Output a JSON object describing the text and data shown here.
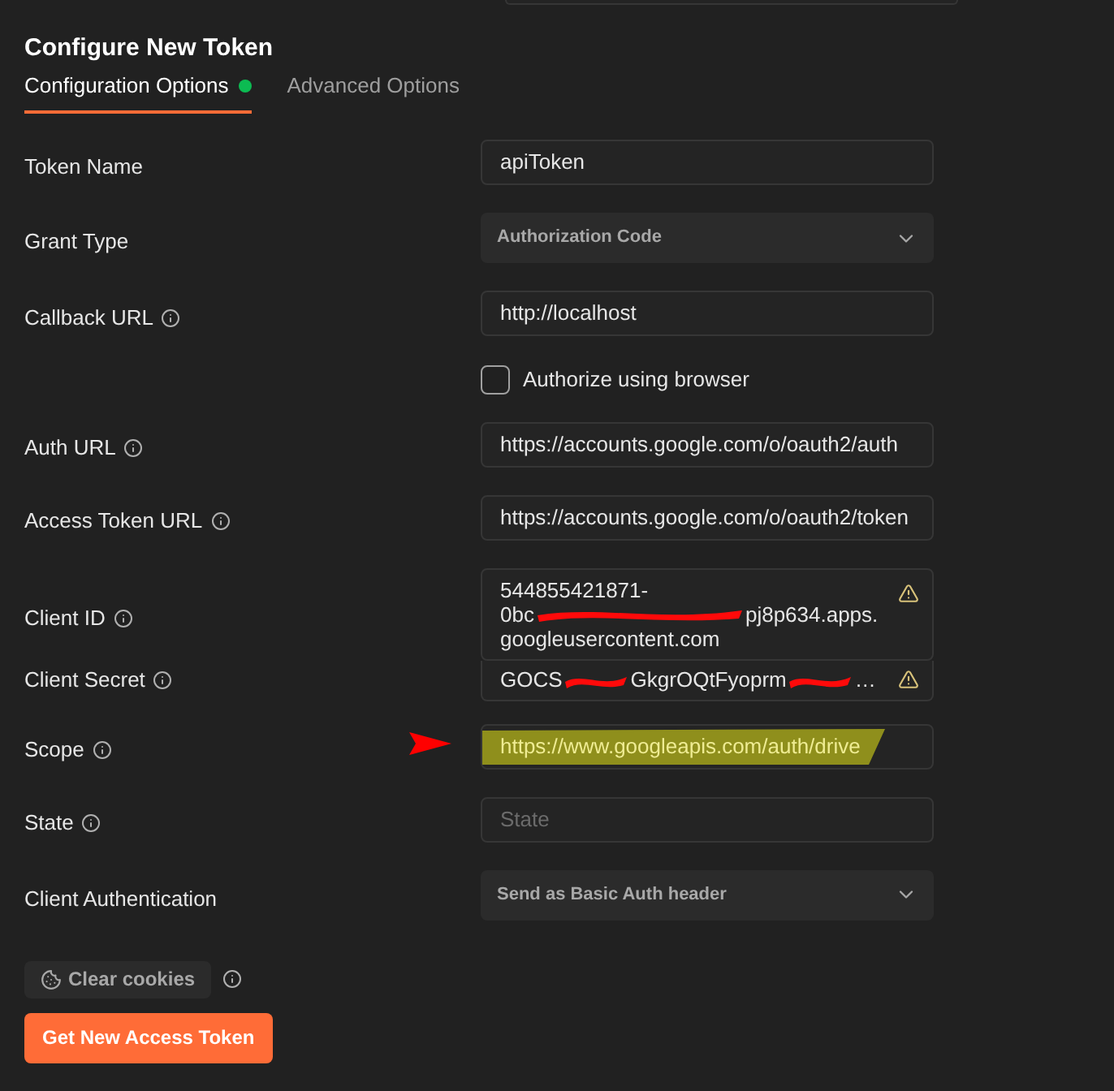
{
  "title": "Configure New Token",
  "tabs": [
    {
      "label": "Configuration Options",
      "selected": true,
      "dot": true
    },
    {
      "label": "Advanced Options",
      "selected": false,
      "dot": false
    }
  ],
  "fields": [
    {
      "kind": "text",
      "label": "Token Name",
      "info": false,
      "value": "apiToken"
    },
    {
      "kind": "select",
      "label": "Grant Type",
      "info": false,
      "value": "Authorization Code"
    },
    {
      "kind": "text",
      "label": "Callback URL",
      "info": true,
      "value": "http://localhost"
    },
    {
      "kind": "checkbox",
      "label": "Authorize using browser",
      "checked": false
    },
    {
      "kind": "text",
      "label": "Auth URL",
      "info": true,
      "value": "https://accounts.google.com/o/oauth2/auth"
    },
    {
      "kind": "text",
      "label": "Access Token URL",
      "info": true,
      "value": "https://accounts.google.com/o/oauth2/token"
    },
    {
      "kind": "redacted",
      "label": "Client ID",
      "info": true,
      "warning": true,
      "lines": [
        [
          "544855421871-"
        ],
        [
          "0bc",
          "pj8p634.apps."
        ],
        [
          "googleusercontent.com"
        ]
      ]
    },
    {
      "kind": "redacted",
      "label": "Client Secret",
      "info": true,
      "warning": true,
      "lines": [
        [
          "GOCS",
          "GkgrOQtFyoprm",
          "…"
        ]
      ]
    },
    {
      "kind": "text",
      "label": "Scope",
      "info": true,
      "value": "https://www.googleapis.com/auth/drive",
      "highlighted": true,
      "arrow": true
    },
    {
      "kind": "text",
      "label": "State",
      "info": true,
      "placeholder": "State"
    },
    {
      "kind": "select",
      "label": "Client Authentication",
      "info": false,
      "value": "Send as Basic Auth header"
    }
  ],
  "clear_cookies": {
    "label": "Clear cookies",
    "info": true
  },
  "submit": "Get New Access Token"
}
